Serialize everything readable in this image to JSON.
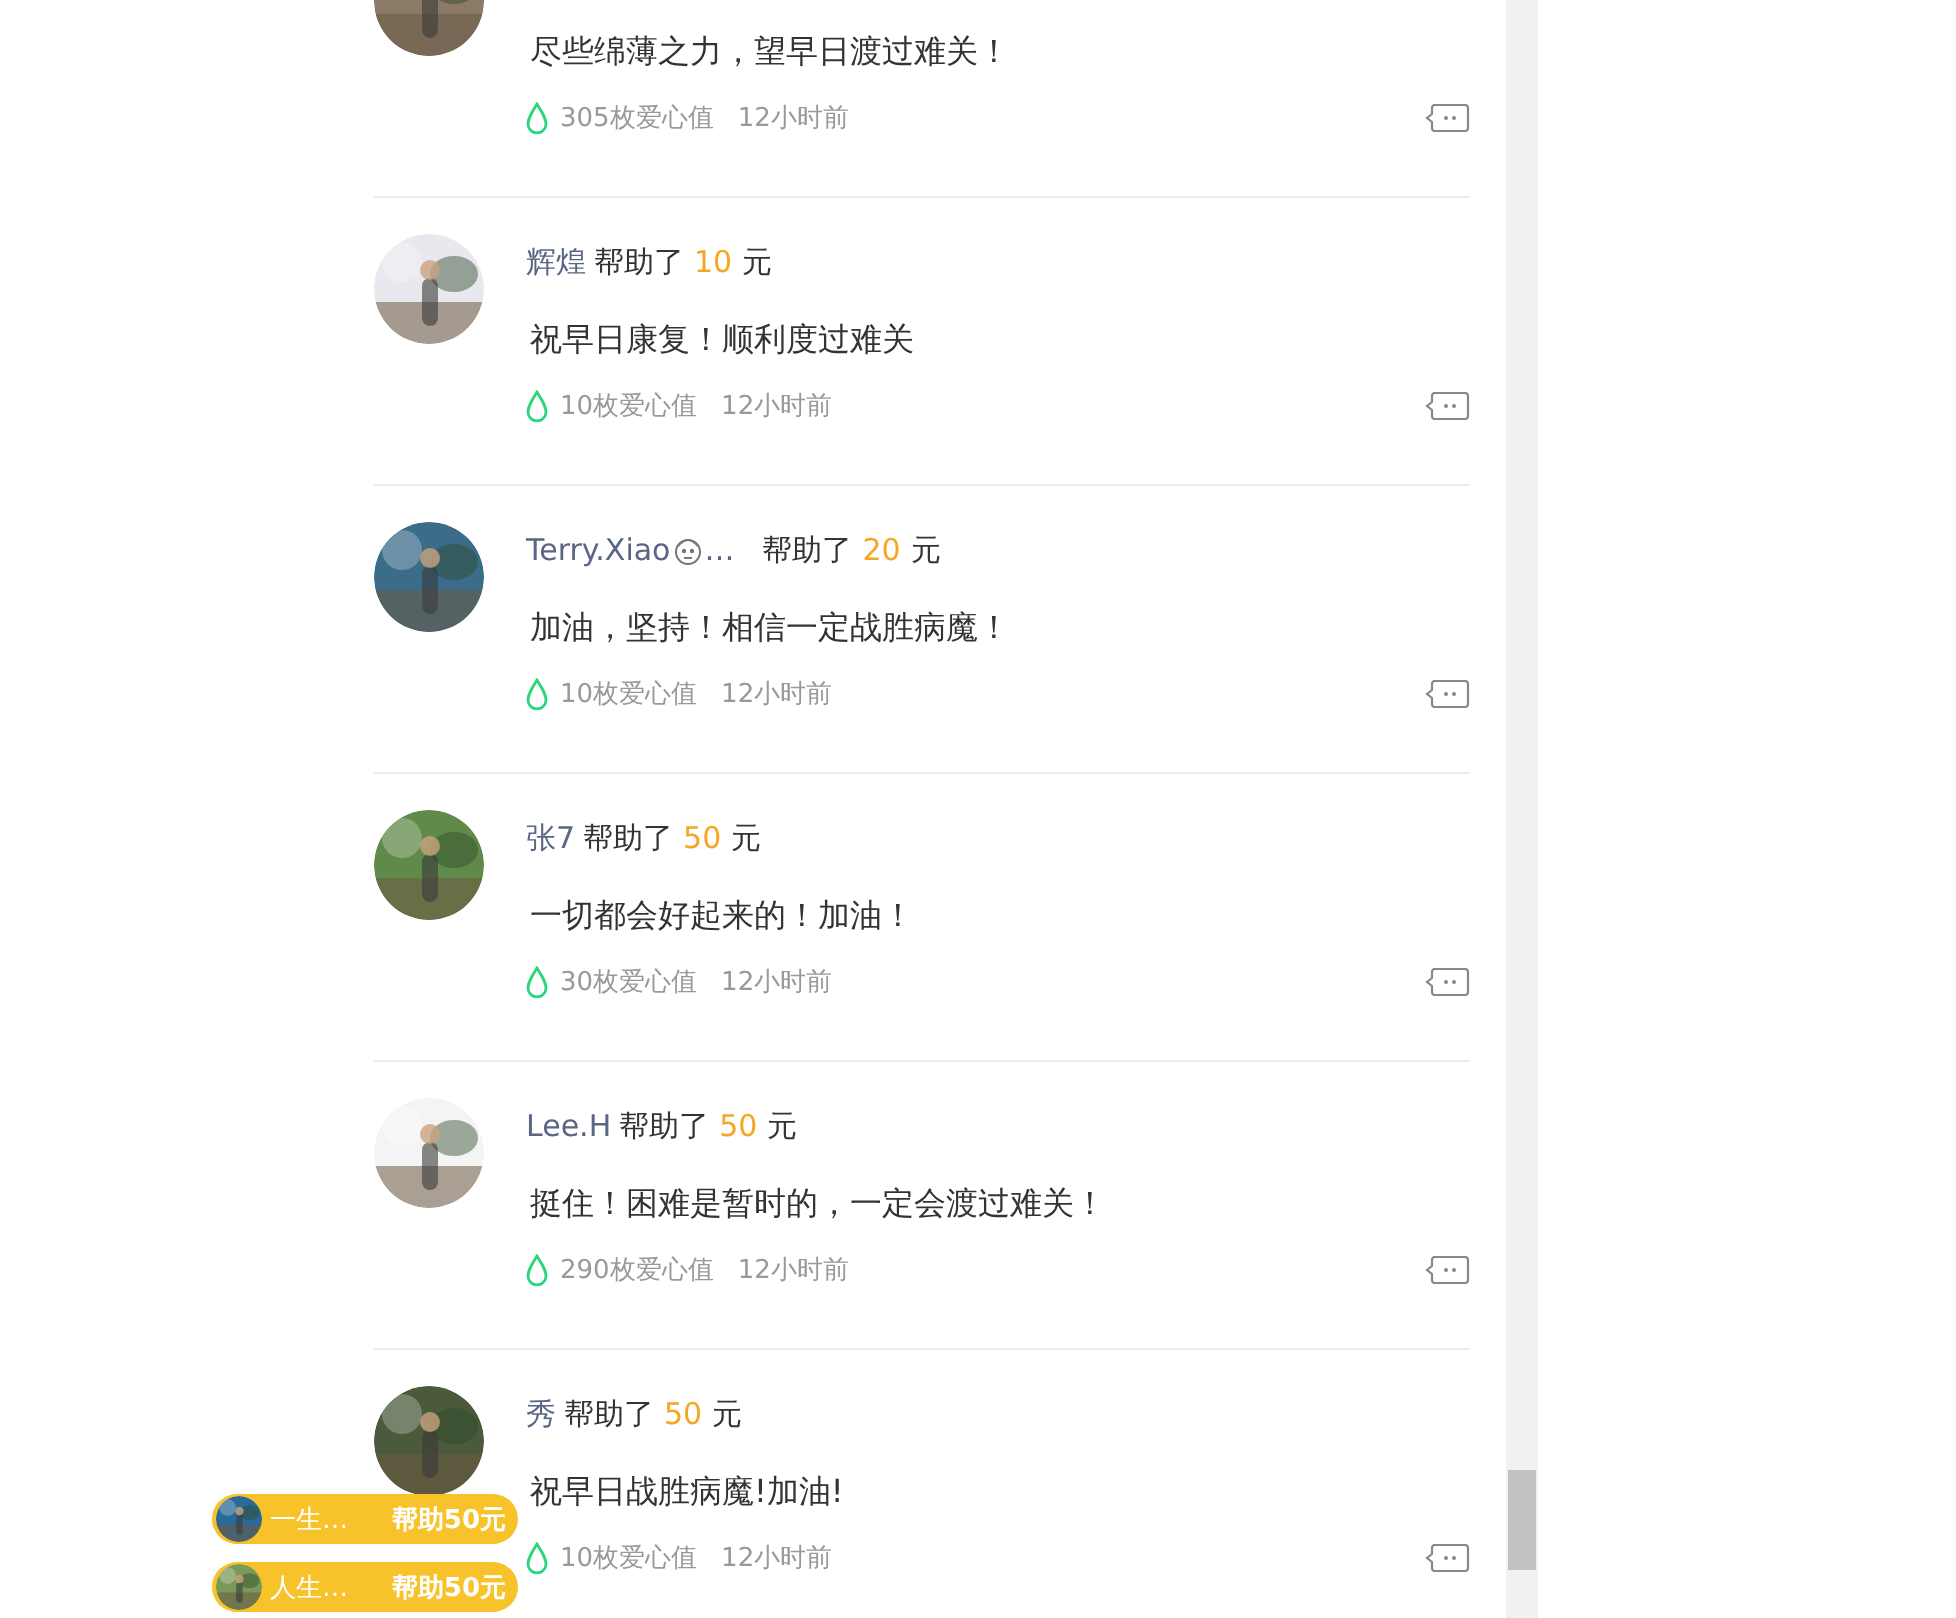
{
  "comments": [
    {
      "message": "尽些绵薄之力，望早日渡过难关！",
      "love": "305枚爱心值",
      "time": "12小时前"
    },
    {
      "name": "辉煌",
      "helped": "帮助了",
      "amount": "10",
      "unit": "元",
      "message": "祝早日康复！顺利度过难关",
      "love": "10枚爱心值",
      "time": "12小时前"
    },
    {
      "name": "Terry.Xiao",
      "name_emoji": true,
      "name_tail": "…",
      "helped": "帮助了",
      "amount": "20",
      "unit": "元",
      "message": "加油，坚持！相信一定战胜病魔！",
      "love": "10枚爱心值",
      "time": "12小时前"
    },
    {
      "name": "张7",
      "helped": "帮助了",
      "amount": "50",
      "unit": "元",
      "message": "一切都会好起来的！加油！",
      "love": "30枚爱心值",
      "time": "12小时前"
    },
    {
      "name": "Lee.H",
      "helped": "帮助了",
      "amount": "50",
      "unit": "元",
      "message": "挺住！困难是暂时的，一定会渡过难关！",
      "love": "290枚爱心值",
      "time": "12小时前"
    },
    {
      "name": "秀",
      "helped": "帮助了",
      "amount": "50",
      "unit": "元",
      "message": "祝早日战胜病魔!加油!",
      "love": "10枚爱心值",
      "time": "12小时前"
    }
  ],
  "toasts": [
    {
      "name": "一生…",
      "text": "帮助50元"
    },
    {
      "name": "人生…",
      "text": "帮助50元"
    }
  ]
}
